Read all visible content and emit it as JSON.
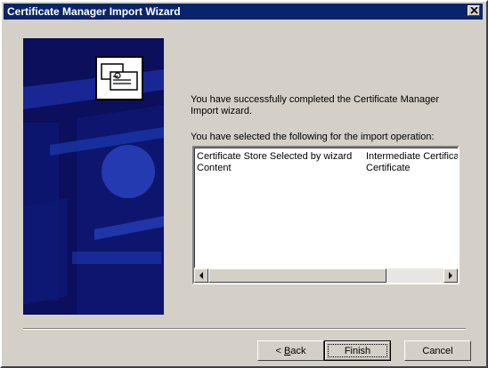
{
  "window": {
    "title": "Certificate Manager Import Wizard"
  },
  "content": {
    "message": "You have successfully completed the Certificate Manager Import wizard.",
    "selection_label": "You have selected the following for the import operation:",
    "rows": [
      {
        "setting": "Certificate Store Selected by wizard",
        "value": "Intermediate Certifica"
      },
      {
        "setting": "Content",
        "value": "Certificate"
      }
    ]
  },
  "buttons": {
    "back_prefix": "< ",
    "back_mnemonic": "B",
    "back_rest": "ack",
    "finish": "Finish",
    "cancel": "Cancel"
  },
  "icons": {
    "close": "close-icon",
    "scroll_left": "scroll-left-arrow-icon",
    "scroll_right": "scroll-right-arrow-icon",
    "wizard_graphic": "certificate-icon"
  },
  "colors": {
    "titlebar": "#0a246a",
    "banner": "#0b0f5c",
    "face": "#d4d0c8"
  }
}
